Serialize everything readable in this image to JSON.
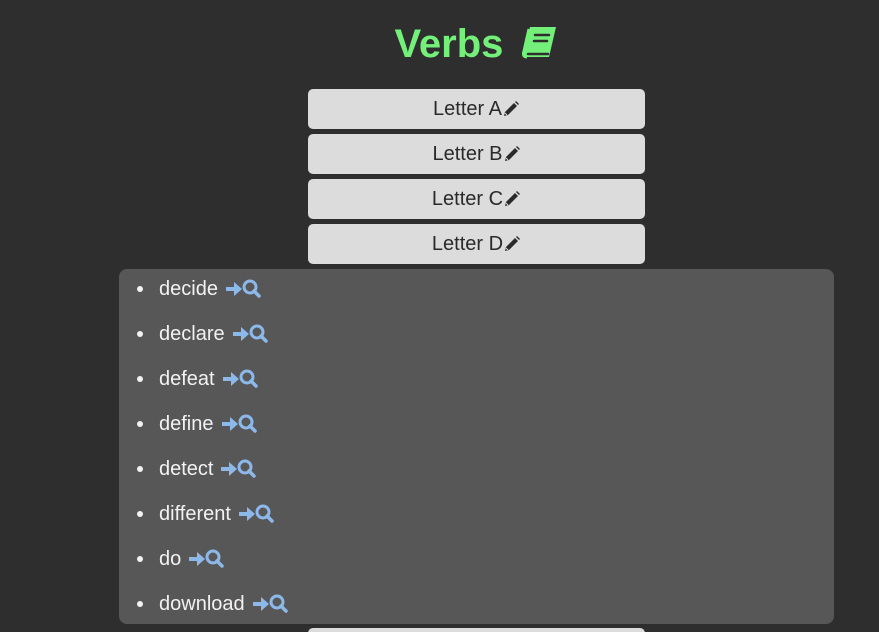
{
  "header": {
    "title": "Verbs",
    "title_icon": "book-icon",
    "title_color": "#74f07a"
  },
  "letters": [
    {
      "label": "Letter A",
      "icon": "pencil-icon"
    },
    {
      "label": "Letter B",
      "icon": "pencil-icon"
    },
    {
      "label": "Letter C",
      "icon": "pencil-icon"
    },
    {
      "label": "Letter D",
      "icon": "pencil-icon"
    }
  ],
  "words": [
    {
      "text": "decide",
      "icon": "arrow-right-search-icon"
    },
    {
      "text": "declare",
      "icon": "arrow-right-search-icon"
    },
    {
      "text": "defeat",
      "icon": "arrow-right-search-icon"
    },
    {
      "text": "define",
      "icon": "arrow-right-search-icon"
    },
    {
      "text": "detect",
      "icon": "arrow-right-search-icon"
    },
    {
      "text": "different",
      "icon": "arrow-right-search-icon"
    },
    {
      "text": "do",
      "icon": "arrow-right-search-icon"
    },
    {
      "text": "download",
      "icon": "arrow-right-search-icon"
    }
  ],
  "colors": {
    "background": "#2e2e2e",
    "panel": "#575757",
    "button": "#dcdcdc",
    "link_icon": "#8db8ea"
  }
}
